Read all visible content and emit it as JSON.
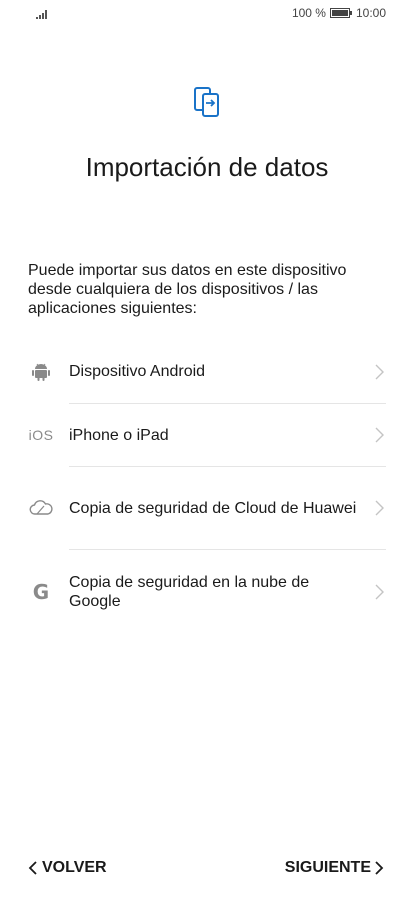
{
  "status_bar": {
    "battery_percent": "100 %",
    "time": "10:00",
    "battery_level": 1.0
  },
  "header": {
    "icon": "phone-transfer-icon",
    "title": "Importación de datos"
  },
  "description": "Puede importar sus datos en este dispositivo desde cualquiera de los dispositivos / las aplicaciones siguientes:",
  "options": [
    {
      "icon": "android-icon",
      "label": "Dispositivo Android"
    },
    {
      "icon": "ios-icon",
      "icon_text": "iOS",
      "label": "iPhone o iPad"
    },
    {
      "icon": "cloud-icon",
      "label": "Copia de seguridad de Cloud de Huawei"
    },
    {
      "icon": "google-icon",
      "icon_text": "G",
      "label": "Copia de seguridad en la nube de Google"
    }
  ],
  "footer": {
    "back_label": "VOLVER",
    "next_label": "SIGUIENTE"
  },
  "colors": {
    "accent": "#1a73c8",
    "text": "#1a1a1a",
    "icon_gray": "#8a8a8a",
    "divider": "#e5e5e5"
  }
}
